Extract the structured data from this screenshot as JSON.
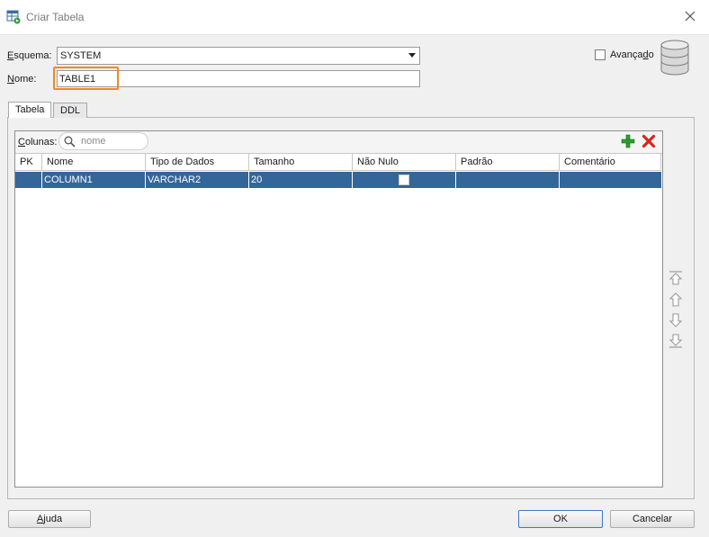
{
  "window": {
    "title": "Criar Tabela"
  },
  "form": {
    "schema_label_u": "E",
    "schema_label_rest": "squema:",
    "schema_value": "SYSTEM",
    "name_label_u": "N",
    "name_label_rest": "ome:",
    "name_value": "TABLE1",
    "advanced_label_main": "Avança",
    "advanced_label_u": "d",
    "advanced_label_end": "o",
    "advanced_checked": false
  },
  "tabs": [
    {
      "label": "Tabela",
      "active": true
    },
    {
      "label": "DDL",
      "active": false
    }
  ],
  "columns_panel": {
    "label_u": "C",
    "label_rest": "olunas:",
    "search_placeholder": "nome",
    "headers": [
      "PK",
      "Nome",
      "Tipo de Dados",
      "Tamanho",
      "Não Nulo",
      "Padrão",
      "Comentário"
    ],
    "rows": [
      {
        "pk": "",
        "nome": "COLUMN1",
        "tipo": "VARCHAR2",
        "tamanho": "20",
        "nao_nulo": false,
        "padrao": "",
        "comentario": ""
      }
    ]
  },
  "buttons": {
    "help_u": "A",
    "help_rest": "juda",
    "ok": "OK",
    "cancel": "Cancelar"
  },
  "colors": {
    "selection": "#336699",
    "highlight": "#f08a1c",
    "add_icon": "#2e9e2e",
    "delete_icon": "#d9251c"
  }
}
